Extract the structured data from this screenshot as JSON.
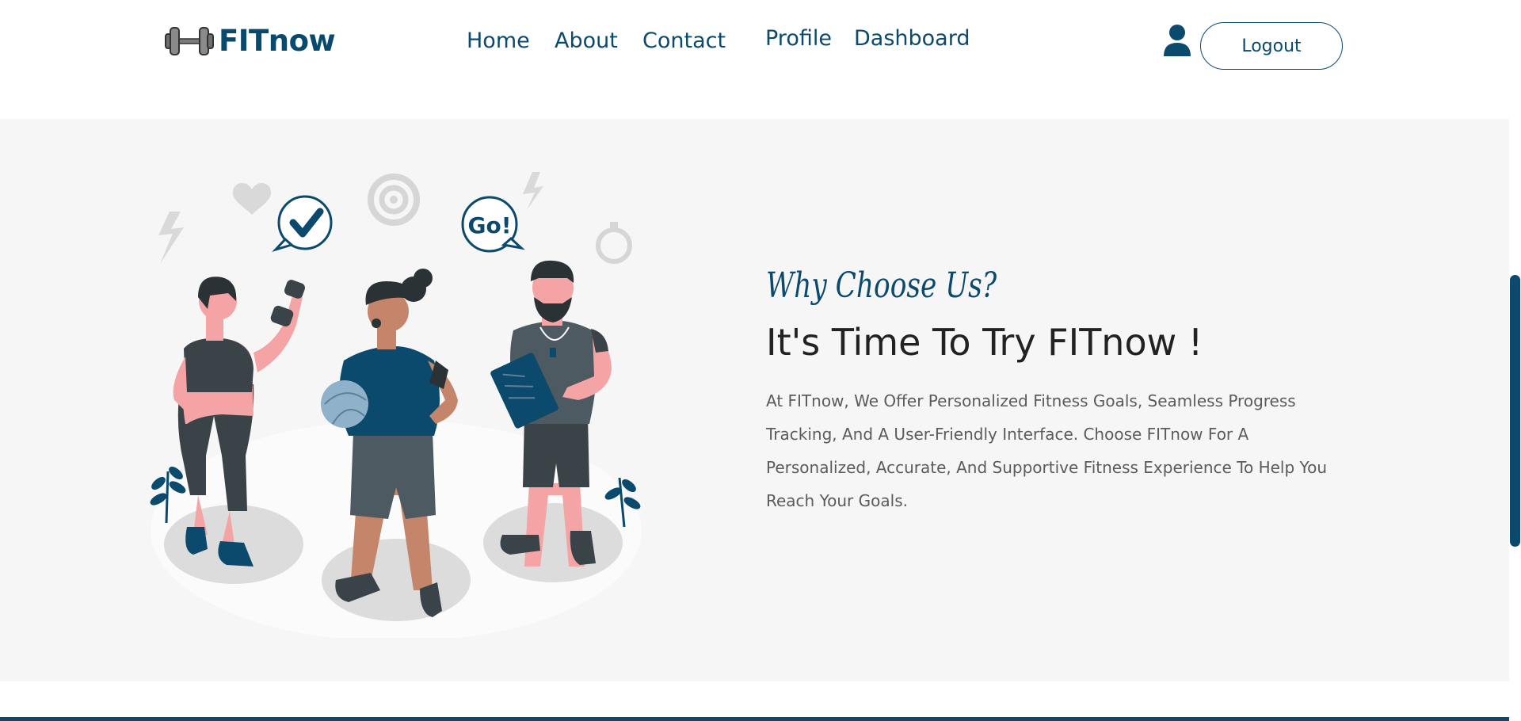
{
  "navbar": {
    "brand": "FITnow",
    "links": {
      "home": "Home",
      "about": "About",
      "contact": "Contact",
      "profile": "Profile",
      "dashboard": "Dashboard"
    },
    "logout_label": "Logout"
  },
  "hero": {
    "tagline": "Why Choose Us?",
    "heading": "It's Time To Try FITnow !",
    "description": "At FITnow, We Offer Personalized Fitness Goals, Seamless Progress Tracking, And A User-Friendly Interface. Choose FITnow For A Personalized, Accurate, And Supportive Fitness Experience To Help You Reach Your Goals.",
    "illustration_badge": "Go!"
  },
  "icons": {
    "brand": "dumbbell-icon",
    "user": "user-icon"
  },
  "colors": {
    "primary": "#0b4a6c",
    "hero_background": "#f6f6f6",
    "heading": "#222222",
    "body_text": "#5b5b5b"
  }
}
